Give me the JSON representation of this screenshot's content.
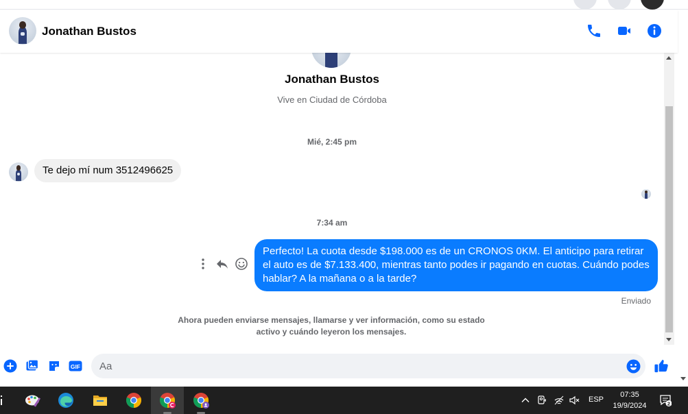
{
  "header": {
    "name": "Jonathan Bustos"
  },
  "profile": {
    "name": "Jonathan Bustos",
    "subtitle": "Vive en Ciudad de Córdoba"
  },
  "thread": {
    "timestamp_1": "Mié, 2:45 pm",
    "incoming_message": "Te dejo mí num 3512496625",
    "timestamp_2": "7:34 am",
    "outgoing_message": "Perfecto! La cuota desde $198.000 es de un CRONOS 0KM. El anticipo para retirar el auto es de $7.133.400, mientras tanto podes ir pagando en cuotas. Cuándo podes hablar? A la mañana o a la tarde?",
    "sent_status": "Enviado",
    "info_text": "Ahora pueden enviarse mensajes, llamarse y ver información, como su estado activo y cuándo leyeron los mensajes."
  },
  "composer": {
    "placeholder": "Aa",
    "gif_label": "GIF"
  },
  "taskbar": {
    "language": "ESP",
    "time": "07:35",
    "date": "19/9/2024",
    "notification_count": "2"
  },
  "colors": {
    "accent": "#0a7cff",
    "icon_blue": "#0866ff",
    "incoming_bubble": "#f0f0f0",
    "taskbar": "#1f1f1f"
  }
}
